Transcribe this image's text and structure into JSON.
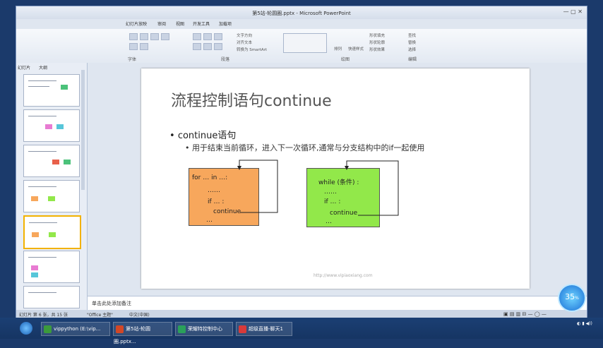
{
  "window": {
    "title": "第5站-轮圆圈.pptx - Microsoft PowerPoint",
    "controls": "— ▢ ✕"
  },
  "tabs": [
    "幻灯片放映",
    "审阅",
    "视图",
    "开发工具",
    "加载项"
  ],
  "ribbon": {
    "groups": [
      "字体",
      "段落",
      "绘图",
      "编辑"
    ],
    "buttons": [
      "文字方向",
      "对齐文本",
      "转换为 SmartArt",
      "排列",
      "快速样式",
      "形状填充",
      "形状轮廓",
      "形状效果",
      "查找",
      "替换",
      "选择"
    ]
  },
  "panel": {
    "tabs": [
      "幻灯片",
      "大纲"
    ]
  },
  "slide": {
    "title": "流程控制语句continue",
    "bullet1": "continue语句",
    "bullet2": "用于结束当前循环，进入下一次循环,通常与分支结构中的if一起使用",
    "box1": {
      "line1": "for  …  in   …:",
      "line2": "……",
      "line3": "if   … :",
      "line4": "continue",
      "line5": "…"
    },
    "box2": {
      "line1": "while  (条件) :",
      "line2": "……",
      "line3": "if   … :",
      "line4": "continue",
      "line5": "…"
    },
    "watermark": "http://www.vipiaoxiang.com"
  },
  "notes": {
    "placeholder": "单击此处添加备注"
  },
  "status": {
    "slide_info": "幻灯片 第 6 张，共 15 张",
    "theme": "\"Office 主题\"",
    "language": "中文(中国)"
  },
  "badge": {
    "value": "35",
    "unit": "%"
  },
  "taskbar": {
    "items": [
      "vippython (E:\\vip...",
      "第5站-轮圆圈.pptx...",
      "荣耀特控制中心",
      "超级直播-聊天1"
    ]
  },
  "colors": {
    "orange_box": "#f7a75c",
    "green_box": "#92e84a",
    "taskbar": "#163563"
  }
}
